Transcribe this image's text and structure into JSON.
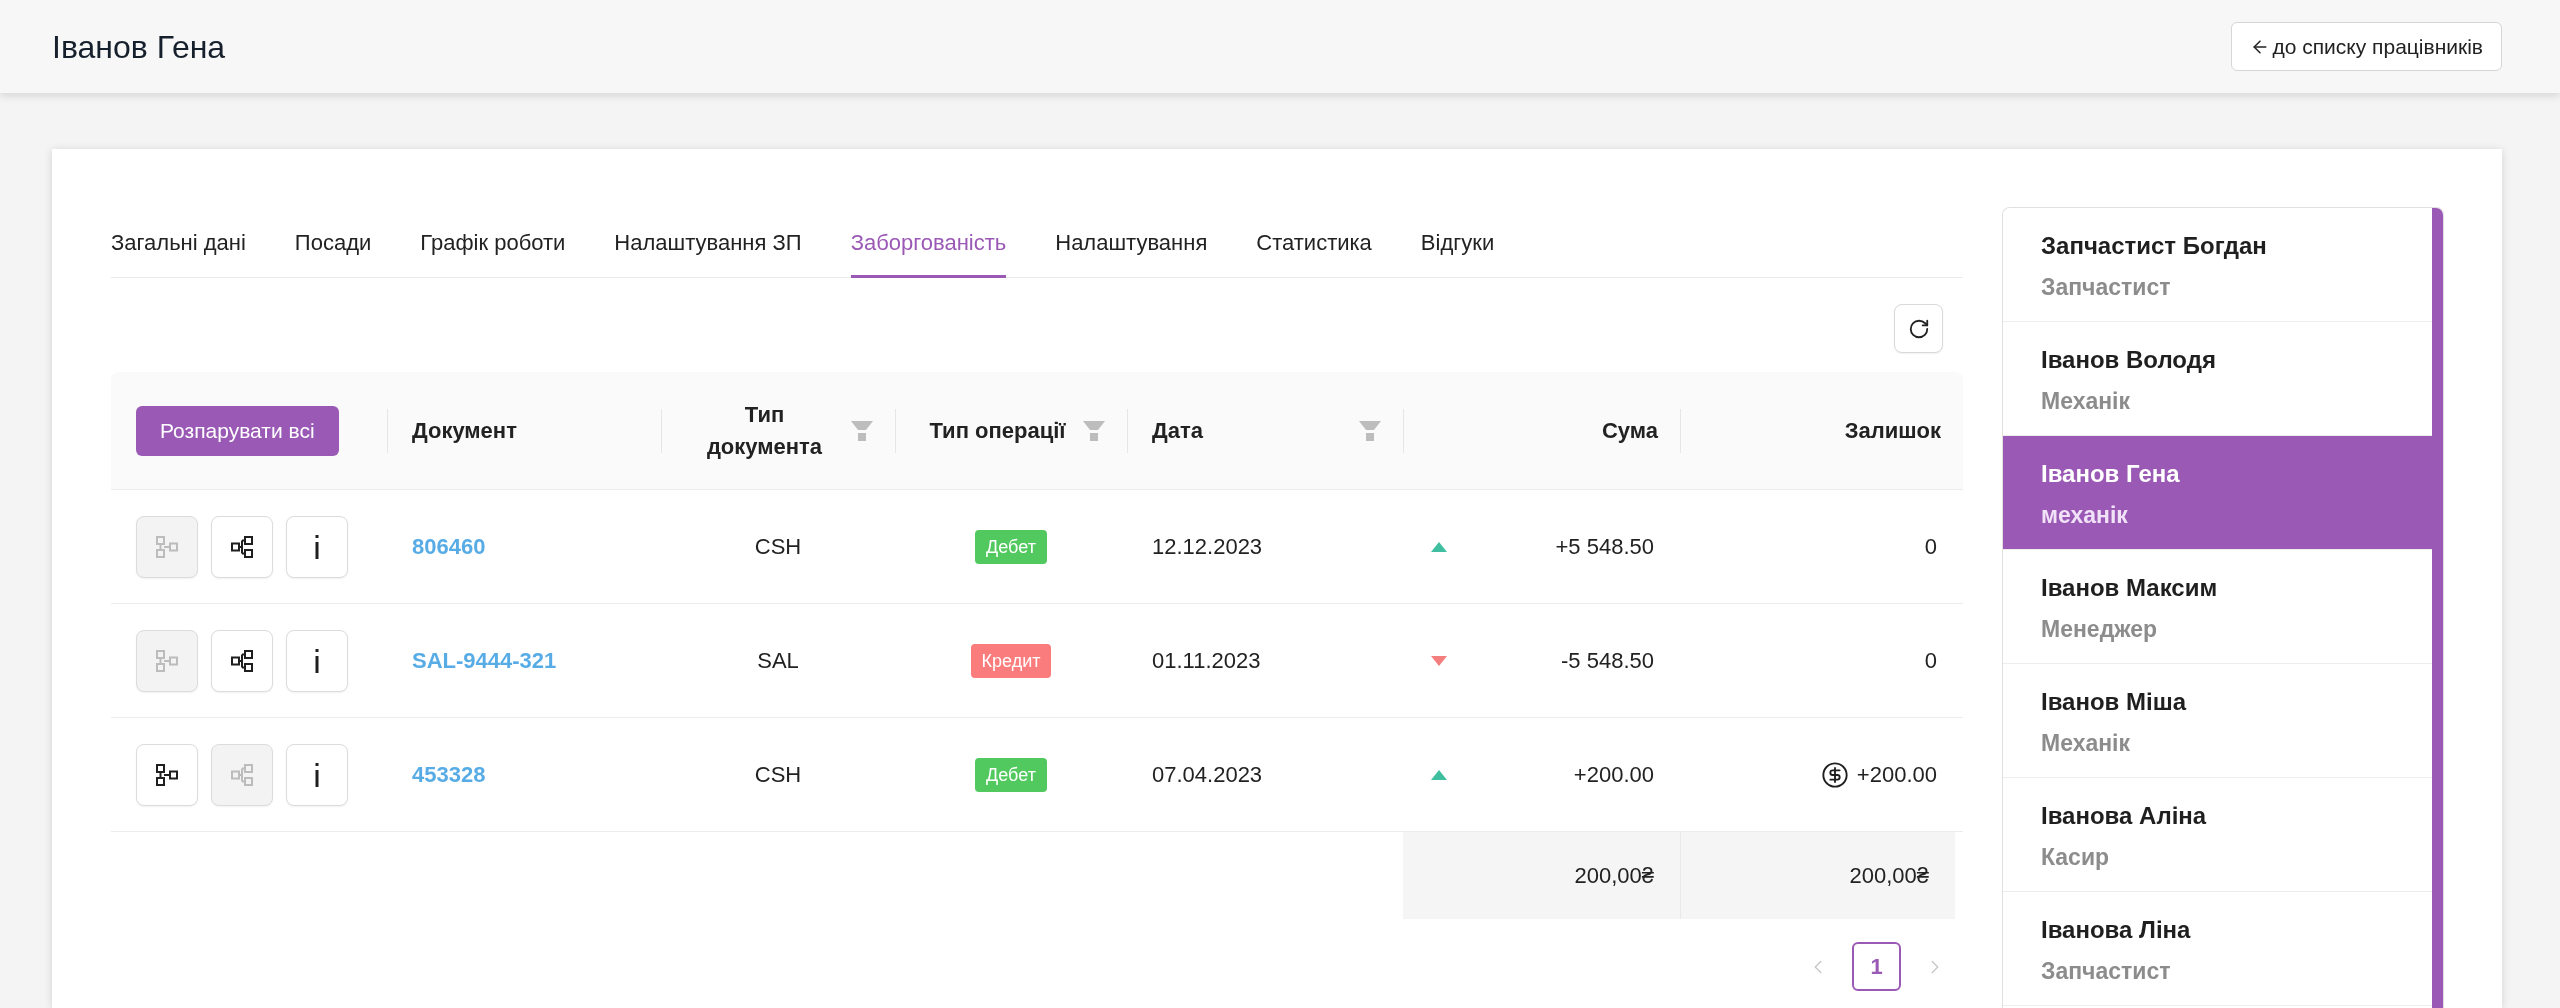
{
  "header": {
    "title": "Іванов Гена",
    "back_button": {
      "label": "до списку працівників"
    }
  },
  "tabs": [
    {
      "label": "Загальні дані",
      "selected": false
    },
    {
      "label": "Посади",
      "selected": false
    },
    {
      "label": "Графік роботи",
      "selected": false
    },
    {
      "label": "Налаштування ЗП",
      "selected": false
    },
    {
      "label": "Заборгованість",
      "selected": true
    },
    {
      "label": "Налаштування",
      "selected": false
    },
    {
      "label": "Статистика",
      "selected": false
    },
    {
      "label": "Відгуки",
      "selected": false
    }
  ],
  "table": {
    "unpair_all_button": {
      "label": "Розпарувати всі"
    },
    "columns": [
      {
        "label": "Документ",
        "filter": false
      },
      {
        "label": "Тип документа",
        "filter": true
      },
      {
        "label": "Тип операції",
        "filter": true
      },
      {
        "label": "Дата",
        "filter": true
      },
      {
        "label": "Сума",
        "filter": false
      },
      {
        "label": "Залишок",
        "filter": false
      }
    ],
    "rows": [
      {
        "actions": [
          {
            "kind": "unpair",
            "disabled": true
          },
          {
            "kind": "pair",
            "disabled": false
          },
          {
            "kind": "info",
            "disabled": false
          }
        ],
        "document": "806460",
        "document_type": "CSH",
        "operation": {
          "label": "Дебет",
          "color": "#52c95f"
        },
        "date": "12.12.2023",
        "rising": true,
        "amount": "+5 548.50",
        "balance": "0",
        "dollar_icon": false
      },
      {
        "actions": [
          {
            "kind": "unpair",
            "disabled": true
          },
          {
            "kind": "pair",
            "disabled": false
          },
          {
            "kind": "info",
            "disabled": false
          }
        ],
        "document": "SAL-9444-321",
        "document_type": "SAL",
        "operation": {
          "label": "Кредит",
          "color": "#fb7c7c"
        },
        "date": "01.11.2023",
        "rising": false,
        "amount": "-5 548.50",
        "balance": "0",
        "dollar_icon": false
      },
      {
        "actions": [
          {
            "kind": "unpair",
            "disabled": false
          },
          {
            "kind": "pair",
            "disabled": true
          },
          {
            "kind": "info",
            "disabled": false
          }
        ],
        "document": "453328",
        "document_type": "CSH",
        "operation": {
          "label": "Дебет",
          "color": "#52c95f"
        },
        "date": "07.04.2023",
        "rising": true,
        "amount": "+200.00",
        "balance": "+200.00",
        "dollar_icon": true
      }
    ],
    "totals": {
      "amount": "200,00₴",
      "balance": "200,00₴"
    }
  },
  "pagination": {
    "prev_disabled": true,
    "pages": [
      {
        "label": "1",
        "selected": true
      }
    ],
    "next_disabled": true
  },
  "sidebar": {
    "items": [
      {
        "name": "Запчастист Богдан",
        "role": "Запчастист",
        "selected": false
      },
      {
        "name": "Іванов Володя",
        "role": "Механік",
        "selected": false
      },
      {
        "name": "Іванов Гена",
        "role": "механік",
        "selected": true
      },
      {
        "name": "Іванов Максим",
        "role": "Менеджер",
        "selected": false
      },
      {
        "name": "Іванов Міша",
        "role": "Механік",
        "selected": false
      },
      {
        "name": "Іванова Аліна",
        "role": "Касир",
        "selected": false
      },
      {
        "name": "Іванова Ліна",
        "role": "Запчастист",
        "selected": false
      }
    ]
  }
}
